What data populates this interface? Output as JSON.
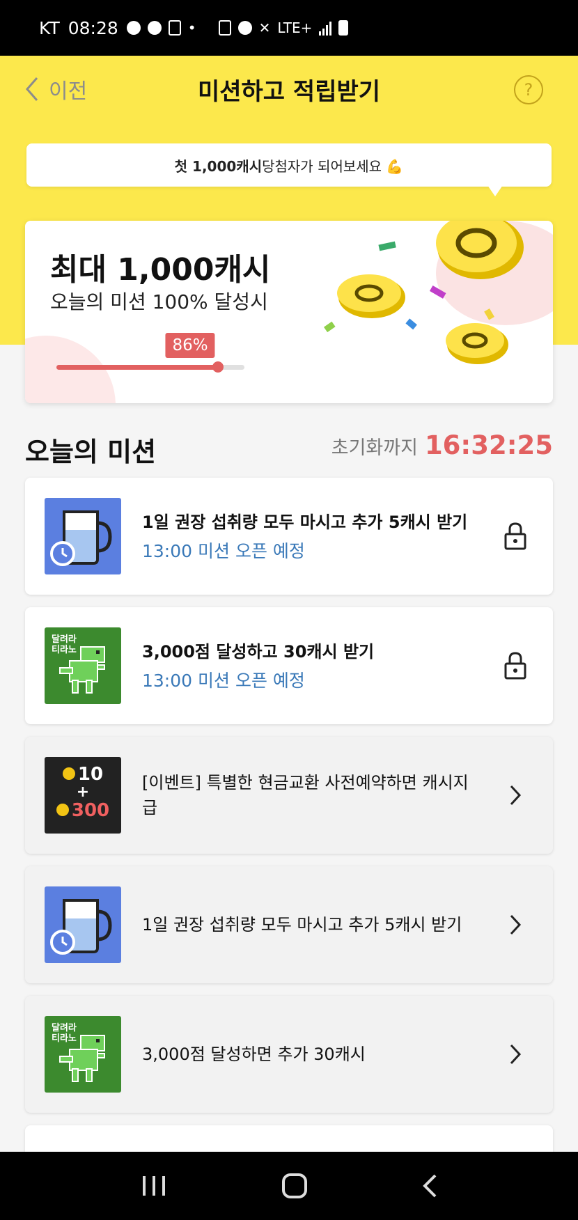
{
  "status_bar": {
    "carrier": "KT",
    "time": "08:28",
    "network": "LTE+"
  },
  "header": {
    "back_label": "이전",
    "title": "미션하고 적립받기",
    "help_symbol": "?"
  },
  "tooltip": {
    "highlight": "첫 1,000캐시",
    "text": " 당첨자가 되어보세요 💪"
  },
  "promo": {
    "heading": "최대 1,000캐시",
    "subheading": "오늘의 미션 100% 달성시",
    "progress_label": "86%",
    "progress_fraction": 0.86,
    "accent_color": "#e26060"
  },
  "section": {
    "title": "오늘의 미션",
    "reset_label": "초기화까지",
    "reset_time": "16:32:25"
  },
  "missions": [
    {
      "title": "1일 권장 섭취량 모두 마시고 추가 5캐시 받기",
      "status": "13:00 미션 오픈 예정",
      "icon": "water-cup-alarm",
      "action": "lock-icon"
    },
    {
      "title": "3,000점 달성하고 30캐시 받기",
      "status": "13:00 미션 오픈 예정",
      "icon": "running-dino",
      "game_label_1": "달려라",
      "game_label_2": "티라노",
      "action": "lock-icon"
    },
    {
      "title": "[이벤트] 특별한 현금교환 사전예약하면 캐시지급",
      "icon": "cash-bonus",
      "bonus_top": "10",
      "bonus_plus": "+",
      "bonus_bottom": "300",
      "action": "chevron-right-icon"
    },
    {
      "title": "1일 권장 섭취량 모두 마시고 추가 5캐시 받기",
      "icon": "water-cup-alarm",
      "action": "chevron-right-icon"
    },
    {
      "title": "3,000점 달성하면 추가 30캐시",
      "icon": "running-dino",
      "game_label_1": "달려라",
      "game_label_2": "티라노",
      "action": "chevron-right-icon"
    }
  ]
}
